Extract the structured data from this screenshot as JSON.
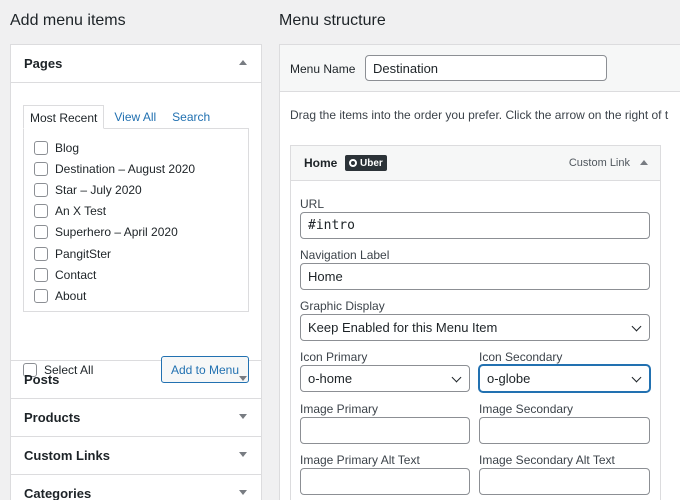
{
  "left": {
    "title": "Add menu items",
    "pages": {
      "heading": "Pages",
      "tabs": [
        "Most Recent",
        "View All",
        "Search"
      ],
      "items": [
        "Blog",
        "Destination – August 2020",
        "Star – July 2020",
        "An X Test",
        "Superhero – April 2020",
        "PangitSter",
        "Contact",
        "About"
      ],
      "select_all": "Select All",
      "add_button": "Add to Menu"
    },
    "sections": [
      "Posts",
      "Products",
      "Custom Links",
      "Categories"
    ]
  },
  "right": {
    "title": "Menu structure",
    "menu_name_label": "Menu Name",
    "menu_name_value": "Destination",
    "instructions": "Drag the items into the order you prefer. Click the arrow on the right of t",
    "item": {
      "title": "Home",
      "badge": "Uber",
      "type": "Custom Link",
      "url_label": "URL",
      "url_value": "#intro",
      "nav_label": "Navigation Label",
      "nav_value": "Home",
      "graphic_label": "Graphic Display",
      "graphic_value": "Keep Enabled for this Menu Item",
      "icon_primary_label": "Icon Primary",
      "icon_primary_value": "o-home",
      "icon_secondary_label": "Icon Secondary",
      "icon_secondary_value": "o-globe",
      "image_primary_label": "Image Primary",
      "image_secondary_label": "Image Secondary",
      "image_primary_alt_label": "Image Primary Alt Text",
      "image_secondary_alt_label": "Image Secondary Alt Text"
    }
  }
}
